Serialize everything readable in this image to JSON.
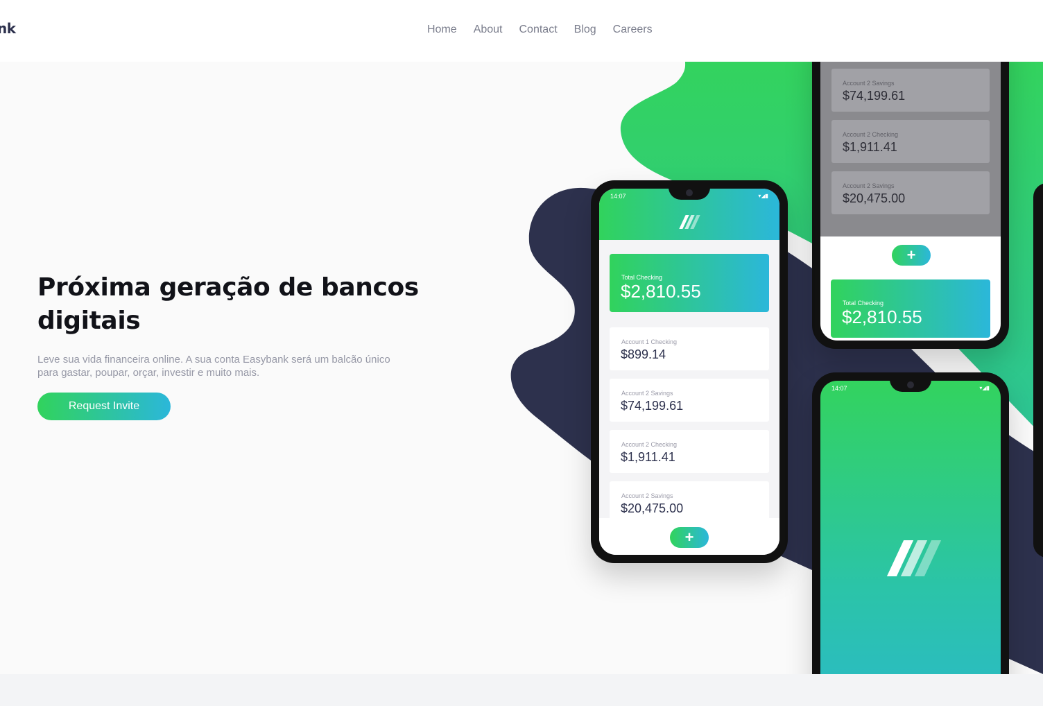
{
  "header": {
    "logo": "nk",
    "nav": [
      "Home",
      "About",
      "Contact",
      "Blog",
      "Careers"
    ]
  },
  "hero": {
    "title": "Próxima geração de bancos digitais",
    "description": "Leve sua vida financeira online. A sua conta Easybank será um balcão único para gastar, poupar, orçar, investir e muito mais.",
    "cta": "Request Invite"
  },
  "phone_main": {
    "time": "14:07",
    "total_label": "Total Checking",
    "total_amount": "$2,810.55",
    "accounts": [
      {
        "label": "Account 1 Checking",
        "amount": "$899.14"
      },
      {
        "label": "Account 2 Savings",
        "amount": "$74,199.61"
      },
      {
        "label": "Account 2 Checking",
        "amount": "$1,911.41"
      },
      {
        "label": "Account 2 Savings",
        "amount": "$20,475.00"
      }
    ]
  },
  "phone_top": {
    "accounts": [
      {
        "label": "Account 2 Savings",
        "amount": "$74,199.61"
      },
      {
        "label": "Account 2 Checking",
        "amount": "$1,911.41"
      },
      {
        "label": "Account 2 Savings",
        "amount": "$20,475.00"
      }
    ],
    "total_label": "Total Checking",
    "total_amount": "$2,810.55"
  },
  "phone_bottom": {
    "time": "14:07"
  },
  "colors": {
    "green": "#31d35c",
    "cyan": "#2bb7da",
    "navy": "#2d314d"
  },
  "icons": {
    "plus": "+",
    "status": "▾◢▮"
  }
}
